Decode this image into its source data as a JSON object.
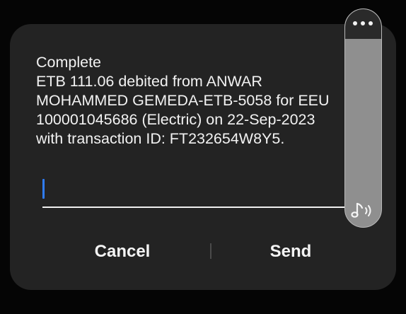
{
  "message": {
    "lines": [
      "Complete",
      "ETB 111.06 debited from ANWAR",
      "MOHAMMED GEMEDA-ETB-5058 for EEU",
      "100001045686 (Electric) on 22-Sep-2023",
      "with transaction ID: FT232654W8Y5."
    ]
  },
  "reply": {
    "value": ""
  },
  "actions": {
    "cancel_label": "Cancel",
    "send_label": "Send"
  },
  "side_panel": {
    "top_icon": "more-options-icon",
    "bottom_icon": "audio-note-icon"
  },
  "colors": {
    "background": "#050505",
    "dialog": "#232323",
    "text": "#f2f2f2",
    "cursor": "#2f7cf6",
    "side_panel": "#8f8f8f"
  }
}
